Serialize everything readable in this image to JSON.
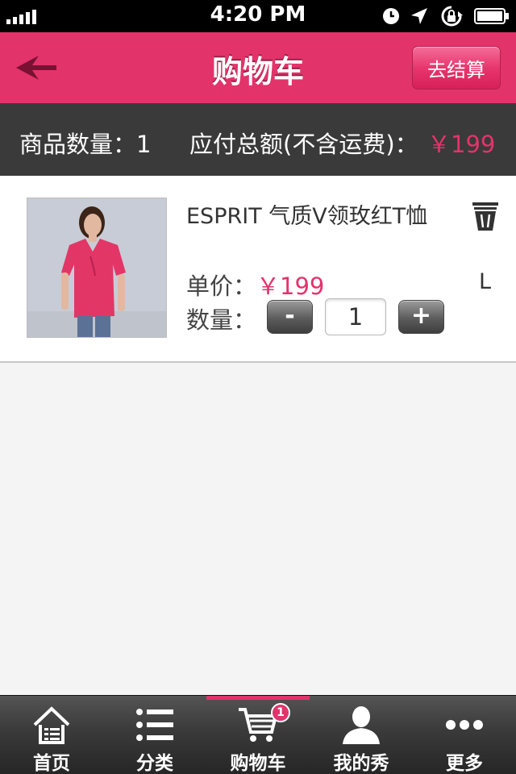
{
  "status_bar": {
    "time": "4:20 PM",
    "icons": [
      "signal-icon",
      "clock-icon",
      "location-arrow-icon",
      "rotation-lock-icon",
      "battery-icon"
    ]
  },
  "header": {
    "title": "购物车",
    "back_icon": "back-arrow-icon",
    "checkout_label": "去结算",
    "accent_color": "#e3336b"
  },
  "summary": {
    "quantity_text": "商品数量：1",
    "total_label": "应付总额(不含运费)：",
    "total_value": "￥199"
  },
  "cart_items": [
    {
      "image": "product-photo-pink-tee",
      "name": "ESPRIT  气质V领玫红T恤",
      "price_label": "单价：",
      "price": "￥199",
      "quantity_label": "数量：",
      "decrement_label": "-",
      "quantity": "1",
      "increment_label": "+",
      "size": "L",
      "delete_icon": "trash-icon"
    }
  ],
  "tab_bar": {
    "tabs": [
      {
        "label": "首页",
        "icon": "home-icon",
        "active": false
      },
      {
        "label": "分类",
        "icon": "list-icon",
        "active": false
      },
      {
        "label": "购物车",
        "icon": "cart-icon",
        "active": true,
        "badge": "1"
      },
      {
        "label": "我的秀",
        "icon": "user-icon",
        "active": false
      },
      {
        "label": "更多",
        "icon": "more-icon",
        "active": false
      }
    ]
  }
}
